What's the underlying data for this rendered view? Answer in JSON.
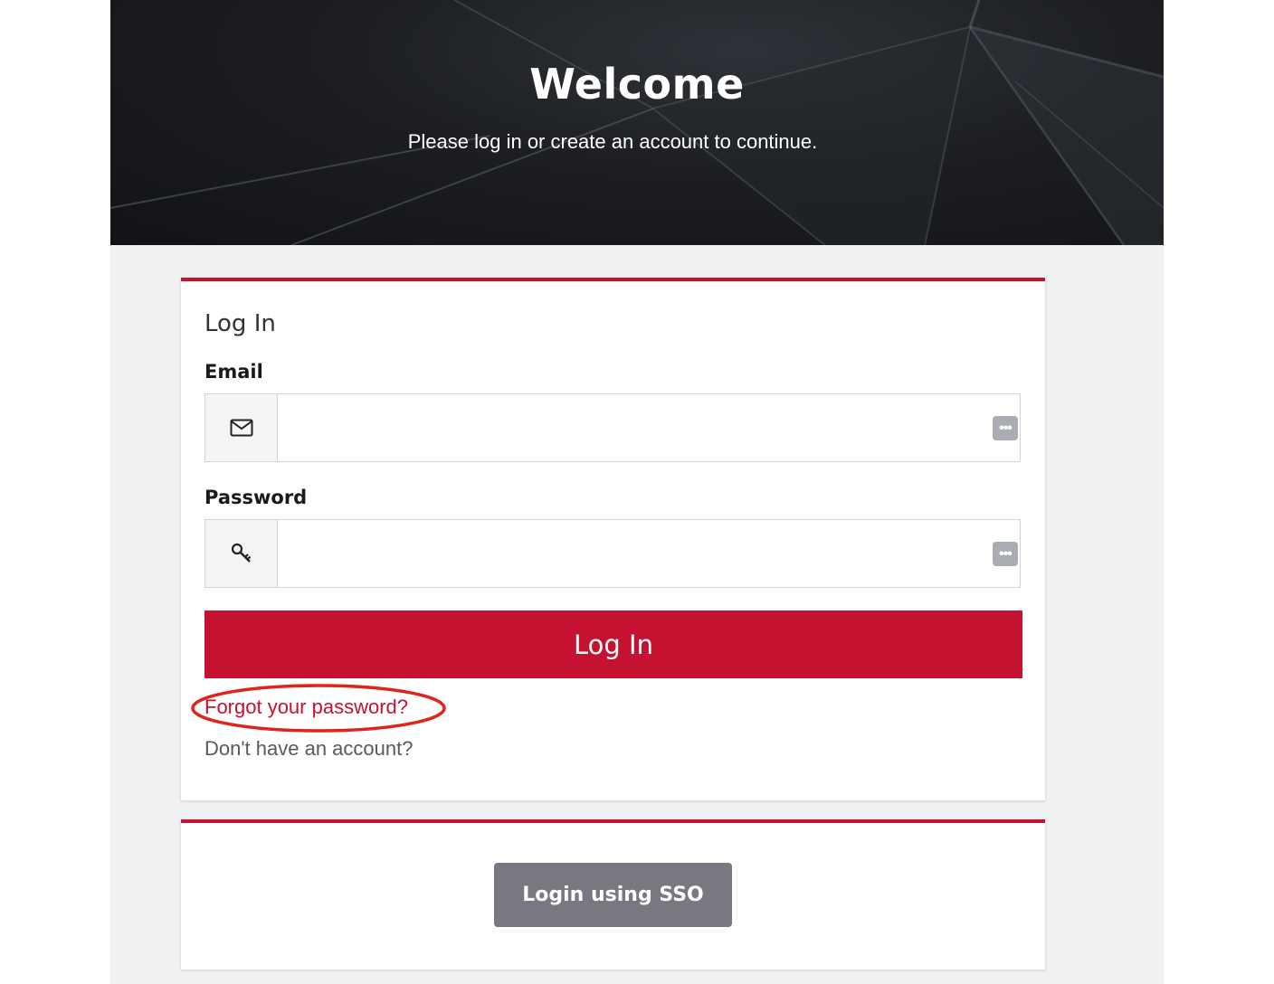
{
  "hero": {
    "title": "Welcome",
    "subtitle": "Please log in or create an account to continue."
  },
  "login_card": {
    "title": "Log In",
    "email": {
      "label": "Email",
      "value": "",
      "placeholder": "",
      "icon": "envelope-icon",
      "badge_icon": "ellipsis-icon"
    },
    "password": {
      "label": "Password",
      "value": "",
      "placeholder": "",
      "icon": "key-icon",
      "badge_icon": "ellipsis-icon"
    },
    "submit_label": "Log In",
    "forgot_link": "Forgot your password?",
    "signup_link": "Don't have an account?"
  },
  "sso_card": {
    "button_label": "Login using SSO"
  },
  "colors": {
    "brand_red": "#c41230",
    "sso_gray": "#777880",
    "hero_dark": "#1c1e22",
    "page_bg": "#f0f1f3",
    "annotation_red": "#e0231b"
  }
}
